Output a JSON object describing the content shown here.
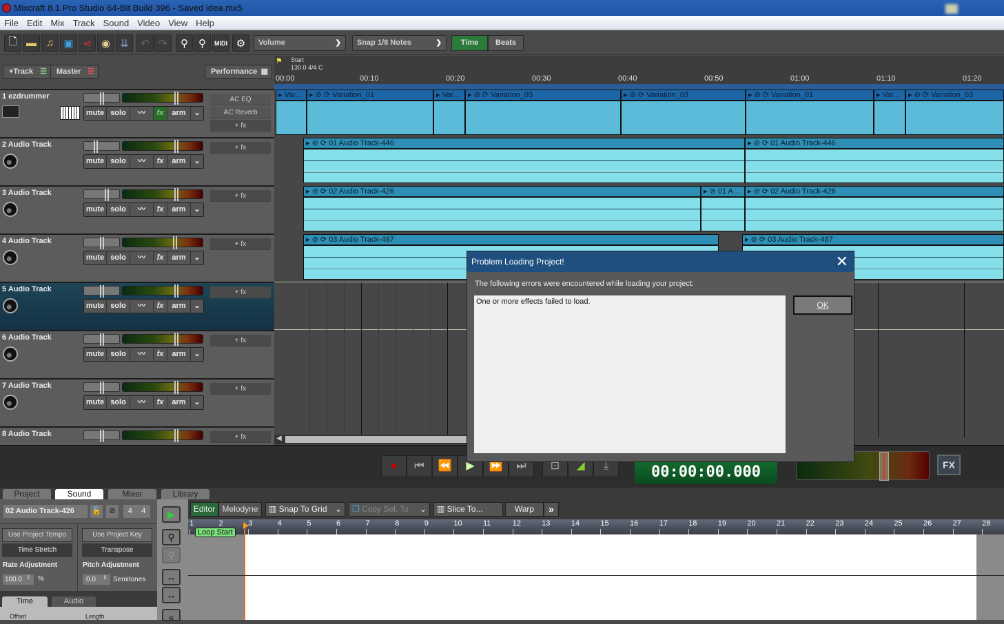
{
  "window": {
    "title": "Mixcraft 8.1 Pro Studio 64-Bit Build 396 - Saved idea.mx5"
  },
  "menu": [
    "File",
    "Edit",
    "Mix",
    "Track",
    "Sound",
    "Video",
    "View",
    "Help"
  ],
  "toolbar": {
    "icons": [
      "new-file-icon",
      "open-folder-icon",
      "open-music-folder-icon",
      "save-icon",
      "share-icon",
      "burn-cd-icon",
      "mixdown-icon",
      "undo-icon",
      "redo-icon",
      "zoom-in-icon",
      "zoom-out-icon",
      "midi-icon",
      "settings-gear-icon"
    ],
    "automation_select": "Volume",
    "snap_select": "Snap 1/8 Notes",
    "time_label": "Time",
    "beats_label": "Beats",
    "active_mode": "Time"
  },
  "track_header": {
    "add_track": "+Track",
    "master": "Master",
    "performance": "Performance"
  },
  "tracks": [
    {
      "name": "1 ezdrummer",
      "type": "instrument",
      "fx": [
        "AC EQ",
        "AC Reverb"
      ],
      "add_fx": "+ fx",
      "fx_active": true
    },
    {
      "name": "2 Audio Track",
      "type": "audio",
      "fx": [],
      "add_fx": "+ fx"
    },
    {
      "name": "3 Audio Track",
      "type": "audio",
      "fx": [],
      "add_fx": "+ fx"
    },
    {
      "name": "4 Audio Track",
      "type": "audio",
      "fx": [],
      "add_fx": "+ fx"
    },
    {
      "name": "5 Audio Track",
      "type": "audio",
      "fx": [],
      "add_fx": "+ fx",
      "selected": true
    },
    {
      "name": "6 Audio Track",
      "type": "audio",
      "fx": [],
      "add_fx": "+ fx"
    },
    {
      "name": "7 Audio Track",
      "type": "audio",
      "fx": [],
      "add_fx": "+ fx"
    },
    {
      "name": "8 Audio Track",
      "type": "audio",
      "fx": [],
      "add_fx": "+ fx"
    }
  ],
  "track_controls": {
    "mute": "mute",
    "solo": "solo",
    "fx": "fx",
    "arm": "arm"
  },
  "timeline": {
    "marker": "Start",
    "tempo": "130.0 4/4 C",
    "ruler": [
      "00:00",
      "00:10",
      "00:20",
      "00:30",
      "00:40",
      "00:50",
      "01:00",
      "01:10",
      "01:20"
    ],
    "clips": {
      "track1": [
        "Var...",
        "Variation_01",
        "Var...",
        "Variation_03",
        "Variation_03",
        "Variation_01",
        "Var...",
        "Variation_03"
      ],
      "track2": [
        "01 Audio Track-446",
        "01 Audio Track-446"
      ],
      "track3": [
        "02 Audio Track-426",
        "01 A...",
        "02 Audio Track-426"
      ],
      "track4": [
        "03 Audio Track-487",
        "03 Audio Track-487"
      ]
    }
  },
  "transport": {
    "clock": "00:00:00.000",
    "fx_label": "FX"
  },
  "bottom": {
    "tabs": [
      "Project",
      "Sound",
      "Mixer",
      "Library"
    ],
    "active_tab": "Sound",
    "clip_name": "02 Audio Track-426",
    "time_sig_num": "4",
    "time_sig_den": "4",
    "use_project_tempo": "Use Project Tempo",
    "time_stretch": "Time Stretch",
    "use_project_key": "Use Project Key",
    "transpose": "Transpose",
    "rate_label": "Rate Adjustment",
    "rate_value": "100.0",
    "rate_unit": "%",
    "pitch_label": "Pitch Adjustment",
    "pitch_value": "0.0",
    "pitch_unit": "Semitones",
    "subtabs": [
      "Time",
      "Audio"
    ],
    "offset_label": "Offset",
    "length_label": "Length",
    "editor_tab": "Editor",
    "melodyne_tab": "Melodyne",
    "snap_to_grid": "Snap To Grid",
    "copy_sel_to": "Copy Sel. To",
    "slice_to": "Slice To...",
    "warp": "Warp",
    "loop_start": "Loop Start",
    "ruler": [
      "1",
      "2",
      "3",
      "4",
      "5",
      "6",
      "7",
      "8",
      "9",
      "10",
      "11",
      "12",
      "13",
      "14",
      "15",
      "16",
      "17",
      "18",
      "19",
      "20",
      "21",
      "22",
      "23",
      "24",
      "25",
      "26",
      "27",
      "28"
    ]
  },
  "dialog": {
    "title": "Problem Loading Project!",
    "message": "The following errors were encountered while loading your project:",
    "details": "One or more effects failed to load.",
    "ok": "OK"
  }
}
